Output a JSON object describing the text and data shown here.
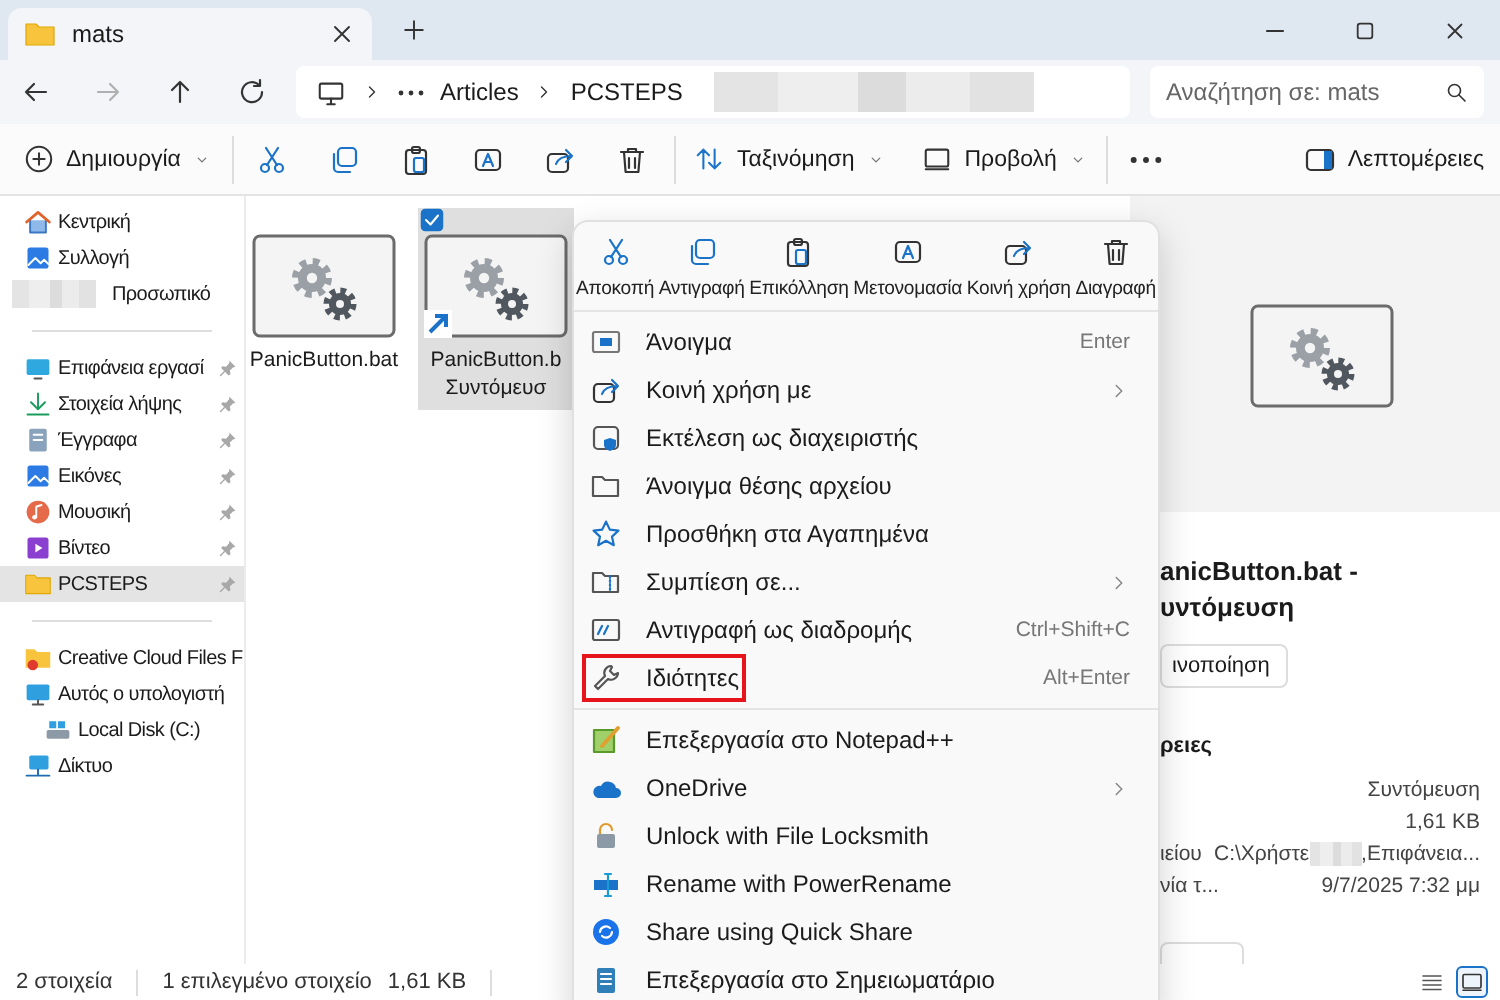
{
  "window": {
    "title": "mats"
  },
  "address_bar": {
    "path": [
      "Articles",
      "PCSTEPS"
    ],
    "search": {
      "placeholder": "Αναζήτηση σε: mats"
    }
  },
  "toolbar": {
    "new": "Δημιουργία",
    "sort": "Ταξινόμηση",
    "view": "Προβολή",
    "details": "Λεπτομέρειες"
  },
  "sidebar": {
    "groups": [
      [
        {
          "label": "Κεντρική",
          "selected": false
        },
        {
          "label": "Συλλογή",
          "selected": false
        },
        {
          "label": "Προσωπικό",
          "selected": false
        }
      ],
      [
        {
          "label": "Επιφάνεια εργασί",
          "pinned": true,
          "selected": false
        },
        {
          "label": "Στοιχεία λήψης",
          "pinned": true,
          "selected": false
        },
        {
          "label": "Έγγραφα",
          "pinned": true,
          "selected": false
        },
        {
          "label": "Εικόνες",
          "pinned": true,
          "selected": false
        },
        {
          "label": "Μουσική",
          "pinned": true,
          "selected": false
        },
        {
          "label": "Βίντεο",
          "pinned": true,
          "selected": false
        },
        {
          "label": "PCSTEPS",
          "pinned": true,
          "selected": true
        }
      ],
      [
        {
          "label": "Creative Cloud Files F",
          "selected": false
        },
        {
          "label": "Αυτός ο υπολογιστή",
          "selected": false,
          "children": [
            {
              "label": "Local Disk (C:)",
              "selected": false
            }
          ]
        },
        {
          "label": "Δίκτυο",
          "selected": false
        }
      ]
    ]
  },
  "files": [
    {
      "name_lines": [
        "PanicButton.bat"
      ],
      "selected": false,
      "shortcut": false
    },
    {
      "name_lines": [
        "PanicButton.b",
        "Συντόμευσ"
      ],
      "selected": true,
      "shortcut": true
    }
  ],
  "context_menu": {
    "actions": [
      {
        "label": "Αποκοπή"
      },
      {
        "label": "Αντιγραφή"
      },
      {
        "label": "Επικόλληση"
      },
      {
        "label": "Μετονομασία"
      },
      {
        "label": "Κοινή χρήση"
      },
      {
        "label": "Διαγραφή"
      }
    ],
    "sections": [
      [
        {
          "label": "Άνοιγμα",
          "shortcut": "Enter",
          "submenu": false,
          "highlighted": false
        },
        {
          "label": "Κοινή χρήση με",
          "submenu": true,
          "highlighted": false
        },
        {
          "label": "Εκτέλεση ως διαχειριστής",
          "submenu": false,
          "highlighted": false
        },
        {
          "label": "Άνοιγμα θέσης αρχείου",
          "submenu": false,
          "highlighted": false
        },
        {
          "label": "Προσθήκη στα Αγαπημένα",
          "submenu": false,
          "highlighted": false
        },
        {
          "label": "Συμπίεση σε...",
          "submenu": true,
          "highlighted": false
        },
        {
          "label": "Αντιγραφή ως διαδρομής",
          "shortcut": "Ctrl+Shift+C",
          "submenu": false,
          "highlighted": false
        },
        {
          "label": "Ιδιότητες",
          "shortcut": "Alt+Enter",
          "submenu": false,
          "highlighted": true
        }
      ],
      [
        {
          "label": "Επεξεργασία στο Notepad++",
          "submenu": false,
          "highlighted": false
        },
        {
          "label": "OneDrive",
          "submenu": true,
          "highlighted": false
        },
        {
          "label": "Unlock with File Locksmith",
          "submenu": false,
          "highlighted": false
        },
        {
          "label": "Rename with PowerRename",
          "submenu": false,
          "highlighted": false
        },
        {
          "label": "Share using Quick Share",
          "submenu": false,
          "highlighted": false
        },
        {
          "label": "Επεξεργασία στο Σημειωματάριο",
          "submenu": false,
          "highlighted": false
        }
      ]
    ]
  },
  "details": {
    "title_lines": [
      "anicButton.bat -",
      "υντόμευση"
    ],
    "button": "ινοποίηση",
    "heading": "ρειες",
    "rows": [
      {
        "value": "Συντόμευση"
      },
      {
        "value": "1,61 KB"
      },
      {
        "label": "ιείου",
        "value": "C:\\Χρήστε",
        "value_end": ",Επιφάνεια..."
      },
      {
        "label": "νία τ...",
        "value": "9/7/2025 7:32 μμ"
      }
    ]
  },
  "status_bar": {
    "count": "2 στοιχεία",
    "selection": "1 επιλεγμένο στοιχείο",
    "size": "1,61 KB",
    "view_modes": [
      {
        "selected": false
      },
      {
        "selected": true
      }
    ]
  }
}
